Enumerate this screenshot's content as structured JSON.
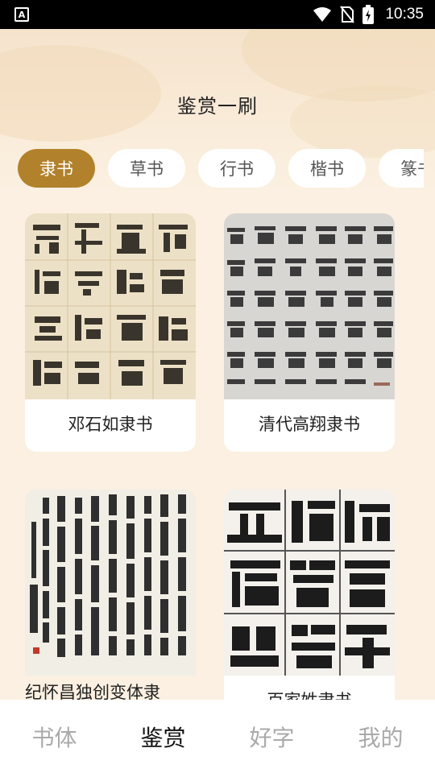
{
  "status_bar": {
    "time": "10:35",
    "app_icon_letter": "A",
    "icons": [
      "app-notification-icon",
      "wifi-icon",
      "no-sim-icon",
      "battery-charging-icon"
    ]
  },
  "header": {
    "title": "鉴赏一刷"
  },
  "tabs": [
    {
      "label": "隶书",
      "active": true
    },
    {
      "label": "草书",
      "active": false
    },
    {
      "label": "行书",
      "active": false
    },
    {
      "label": "楷书",
      "active": false
    },
    {
      "label": "篆书",
      "active": false
    }
  ],
  "cards": [
    {
      "label": "邓石如隶书"
    },
    {
      "label": "清代高翔隶书"
    },
    {
      "label": "纪怀昌独创变体隶"
    },
    {
      "label": "百家姓隶书"
    }
  ],
  "bottom_nav": [
    {
      "label": "书体",
      "active": false
    },
    {
      "label": "鉴赏",
      "active": true
    },
    {
      "label": "好字",
      "active": false
    },
    {
      "label": "我的",
      "active": false
    }
  ],
  "colors": {
    "accent": "#b2812c",
    "background": "#fbf0e1",
    "nav_active": "#111111",
    "nav_inactive": "#aaaaaa"
  }
}
